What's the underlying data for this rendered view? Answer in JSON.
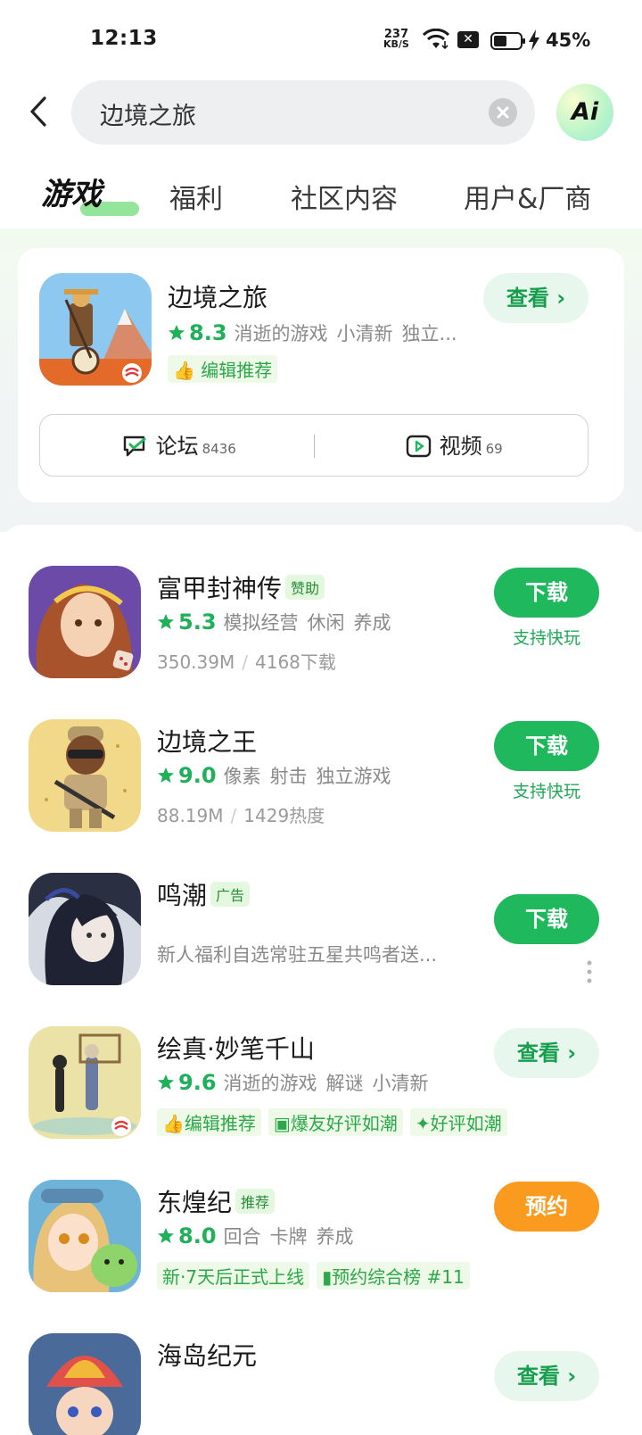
{
  "status_bar": {
    "time": "12:13",
    "net_speed_value": "237",
    "net_speed_unit": "KB/S",
    "battery": "45%"
  },
  "search": {
    "query": "边境之旅"
  },
  "ai_button": {
    "label": "Ai"
  },
  "tabs": [
    {
      "label": "游戏",
      "active": true
    },
    {
      "label": "福利"
    },
    {
      "label": "社区内容"
    },
    {
      "label": "用户&厂商"
    }
  ],
  "featured": {
    "title": "边境之旅",
    "rating": "8.3",
    "tags": [
      "消逝的游戏",
      "小清新",
      "独立..."
    ],
    "editor_badge": "编辑推荐",
    "view_label": "查看",
    "forum_label": "论坛",
    "forum_count": "8436",
    "video_label": "视频",
    "video_count": "69"
  },
  "apps": [
    {
      "title": "富甲封神传",
      "pill": "赞助",
      "rating": "5.3",
      "tags": [
        "模拟经营",
        "休闲",
        "养成"
      ],
      "size": "350.39M",
      "stat": "4168下载",
      "button": "下载",
      "sub_label": "支持快玩"
    },
    {
      "title": "边境之王",
      "rating": "9.0",
      "tags": [
        "像素",
        "射击",
        "独立游戏"
      ],
      "size": "88.19M",
      "stat": "1429热度",
      "button": "下载",
      "sub_label": "支持快玩"
    },
    {
      "title": "鸣潮",
      "pill": "广告",
      "description": "新人福利自选常驻五星共鸣者送...",
      "button": "下载"
    },
    {
      "title": "绘真·妙笔千山",
      "rating": "9.6",
      "tags": [
        "消逝的游戏",
        "解谜",
        "小清新"
      ],
      "badges": [
        "编辑推荐",
        "爆友好评如潮",
        "好评如潮"
      ],
      "button": "查看"
    },
    {
      "title": "东煌纪",
      "pill": "推荐",
      "rating": "8.0",
      "tags": [
        "回合",
        "卡牌",
        "养成"
      ],
      "badges": [
        "新·7天后正式上线",
        "预约综合榜 #11"
      ],
      "button": "预约"
    },
    {
      "title": "海岛纪元",
      "button": "查看"
    }
  ],
  "colors": {
    "accent_green": "#20b85c",
    "reserve_orange": "#fa9a1e",
    "rating_green": "#1fb05a"
  }
}
